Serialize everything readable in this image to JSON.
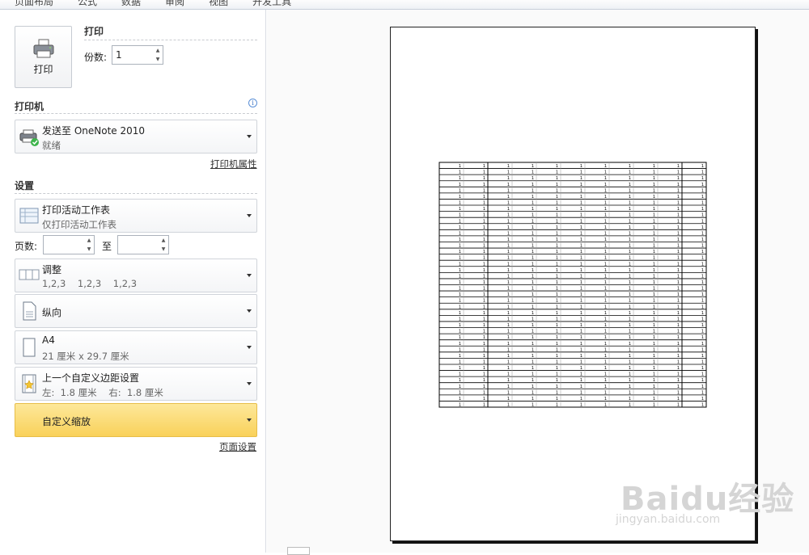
{
  "ribbon": {
    "tabs": [
      "页面布局",
      "公式",
      "数据",
      "审阅",
      "视图",
      "开发工具"
    ]
  },
  "print": {
    "button_label": "打印",
    "section_title": "打印",
    "copies_label": "份数:",
    "copies_value": "1"
  },
  "printer": {
    "section_title": "打印机",
    "name": "发送至 OneNote 2010",
    "status": "就绪",
    "properties_link": "打印机属性"
  },
  "settings": {
    "section_title": "设置",
    "scope": {
      "title": "打印活动工作表",
      "subtitle": "仅打印活动工作表"
    },
    "pages_label": "页数:",
    "pages_from": "",
    "pages_to_label": "至",
    "pages_to": "",
    "collate": {
      "title": "调整",
      "subtitle": "1,2,3    1,2,3    1,2,3"
    },
    "orientation": {
      "title": "纵向"
    },
    "paper": {
      "title": "A4",
      "subtitle": "21 厘米 x 29.7 厘米"
    },
    "margins": {
      "title": "上一个自定义边距设置",
      "subtitle": "左:  1.8 厘米    右:  1.8 厘米"
    },
    "scaling": {
      "title": "自定义缩放"
    },
    "page_setup_link": "页面设置"
  },
  "preview": {
    "cell_value": "1",
    "rows": 40,
    "cols": 11
  },
  "watermark": {
    "brand": "Baidu经验",
    "url": "jingyan.baidu.com"
  },
  "colors": {
    "accent": "#f9d15a",
    "info": "#3d74c6"
  }
}
